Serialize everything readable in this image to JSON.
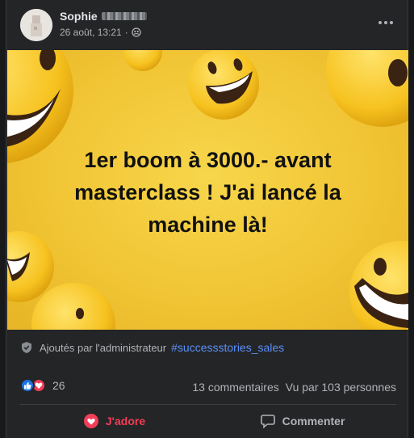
{
  "post": {
    "author_name": "Sophie",
    "timestamp": "26 août, 13:21",
    "meta_separator": "·",
    "privacy_icon": "friends-globe-icon",
    "image_text": "1er boom à 3000.- avant masterclass ! J'ai lancé la machine là!",
    "image_text_lines": [
      "1er boom à 3000.- avant",
      "masterclass ! J'ai lancé la",
      "machine là!"
    ]
  },
  "tag": {
    "admin_label": "Ajoutés par l'administrateur",
    "hashtag": "#successstories_sales"
  },
  "reactions": {
    "count": "26",
    "comments": "13 commentaires",
    "seen_by": "Vu par 103 personnes"
  },
  "actions": {
    "love_label": "J'adore",
    "comment_label": "Commenter"
  },
  "colors": {
    "background": "#242526",
    "accent_link": "#5b8ff9",
    "love": "#f33e58",
    "like": "#1b74e4",
    "image_bg": "#f1c535"
  }
}
